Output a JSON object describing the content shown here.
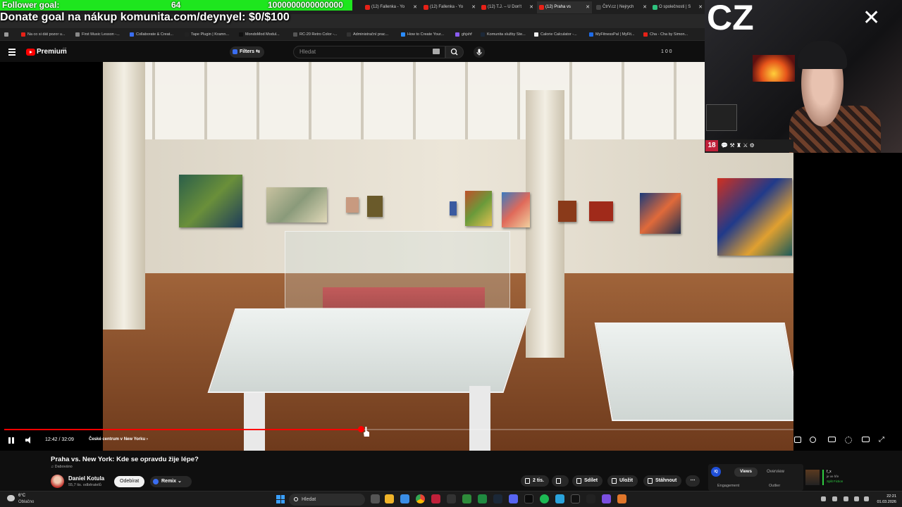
{
  "overlay": {
    "follower_goal_label": "Follower goal:",
    "follower_count": "64",
    "follower_target": "1000000000000000",
    "donate_goal": "Donate goal na nákup komunita.com/deynyel: $0/$100",
    "webcam_brand": "CZ",
    "webcam_badge": "18"
  },
  "browser": {
    "tabs": [
      {
        "label": "(12) Fallenka - Yo",
        "active": false
      },
      {
        "label": "(12) Fallenka - Yo",
        "active": false
      },
      {
        "label": "(12) T.J. – U Don't",
        "active": false
      },
      {
        "label": "(12) Praha vs",
        "active": true
      },
      {
        "label": "ČtrV.cz | Nejrych",
        "active": false
      },
      {
        "label": "O společnosti | S",
        "active": false
      }
    ],
    "bookmarks": [
      "Na co si dát pozor u...",
      "First Music Lesson -...",
      "Collaborate & Creat...",
      "Tape Plugin | Kramn...",
      "MondoMod Modul...",
      "RC-20 Retro Color -...",
      "Administrační prac...",
      "How to Create Your...",
      "ghjshf",
      "Komunita služby Ste...",
      "Calorie Calculator -...",
      "MyFitnessPal | MyFit...",
      "Cha - Cha by Simon..."
    ]
  },
  "masthead": {
    "brand": "Premium",
    "region": "CZ",
    "filters_label": "Filters",
    "search_placeholder": "Hledat",
    "counters": "1  0  0"
  },
  "player": {
    "time": "12:42 / 32:09",
    "chapter": "České centrum v New Yorku",
    "progress": 0.452
  },
  "video": {
    "title": "Praha vs. New York: Kde se opravdu žije lépe?",
    "dub_label": "Dabováno",
    "channel": "Daniel Kotula",
    "subscribers": "55,7 tis. odběratelů",
    "unsubscribe_label": "Odebírat",
    "remix_label": "Remix",
    "likes": "2 tis.",
    "share_label": "Sdílet",
    "save_label": "Uložit",
    "download_label": "Stáhnout"
  },
  "analytics": {
    "badge": "IQ",
    "tab_views": "Views",
    "tab_overview": "Overview",
    "sub_engagement": "Engagement",
    "sub_outlier": "Outlier"
  },
  "friend": {
    "name": "f_x",
    "status": "je ve hře",
    "game": "Split Fiction"
  },
  "taskbar": {
    "temperature": "6°C",
    "weather": "Oblačno",
    "search_label": "Hledat",
    "time": "22:21",
    "date": "01.03.2026"
  },
  "colors": {
    "accent_red": "#ff0000",
    "goal_green": "#1ee61e",
    "background": "#0f0f0f"
  }
}
